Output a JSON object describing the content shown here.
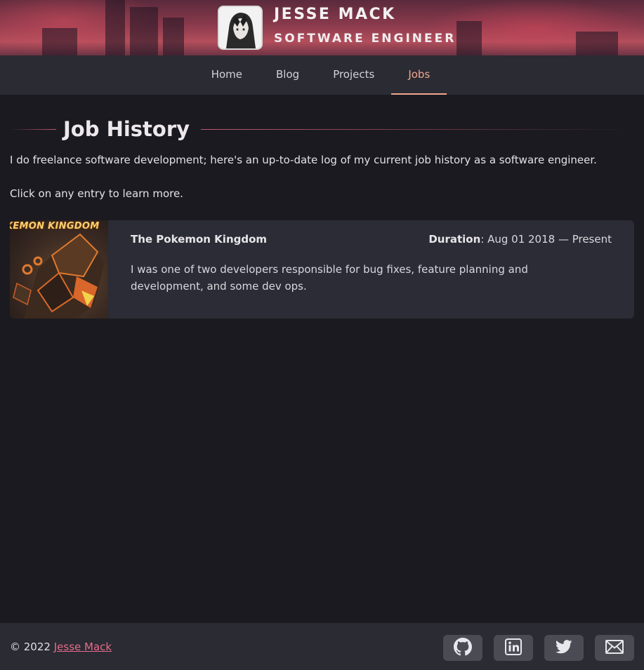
{
  "header": {
    "name": "JESSE MACK",
    "role": "SOFTWARE ENGINEER"
  },
  "nav": {
    "items": [
      {
        "label": "Home",
        "active": false
      },
      {
        "label": "Blog",
        "active": false
      },
      {
        "label": "Projects",
        "active": false
      },
      {
        "label": "Jobs",
        "active": true
      }
    ]
  },
  "main": {
    "title": "Job History",
    "intro": "I do freelance software development; here's an up-to-date log of my current job history as a software engineer.",
    "hint": "Click on any entry to learn more.",
    "jobs": [
      {
        "thumb_text": "KEMON KINGDOM",
        "title": "The Pokemon Kingdom",
        "duration_label": "Duration",
        "duration_value": ": Aug 01 2018 — Present",
        "description": "I was one of two developers responsible for bug fixes, feature planning and development, and some dev ops."
      }
    ]
  },
  "footer": {
    "copyright": "© 2022",
    "author_link": "Jesse Mack",
    "social": [
      "github-icon",
      "linkedin-icon",
      "twitter-icon",
      "mail-icon"
    ]
  },
  "colors": {
    "accent": "#f0a890",
    "link": "#e86a8a",
    "background": "#1b1a20",
    "panel": "#2a2b33"
  }
}
